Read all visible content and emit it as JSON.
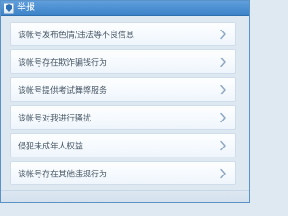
{
  "window": {
    "title": "举报"
  },
  "menu": {
    "items": [
      {
        "label": "该帐号发布色情/违法等不良信息",
        "icon": "chevron-right-icon"
      },
      {
        "label": "该帐号存在欺诈骗钱行为",
        "icon": "chevron-right-icon"
      },
      {
        "label": "该帐号提供考试舞弊服务",
        "icon": "chevron-right-icon"
      },
      {
        "label": "该帐号对我进行骚扰",
        "icon": "chevron-right-icon"
      },
      {
        "label": "侵犯未成年人权益",
        "icon": "chevron-right-icon"
      },
      {
        "label": "该帐号存在其他违规行为",
        "icon": "chevron-right-icon"
      }
    ]
  },
  "colors": {
    "titlebar": "#4a8fd2",
    "window_bg": "#dde8f1",
    "item_border": "#cfdceb",
    "item_text": "#4a5968",
    "chevron": "#8ea8c4"
  }
}
